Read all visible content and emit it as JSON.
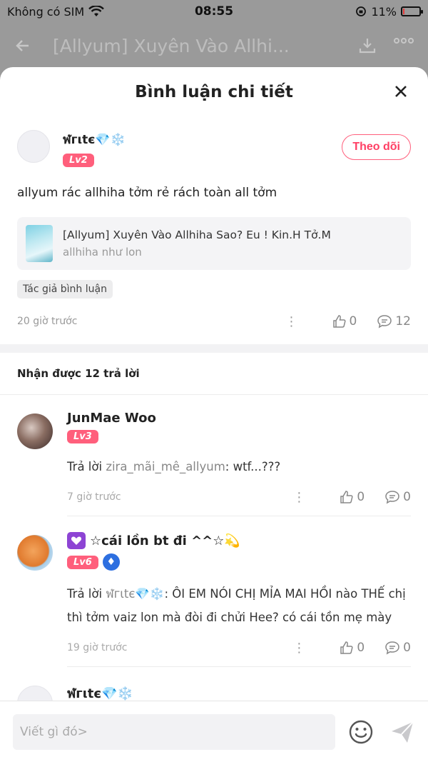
{
  "status_bar": {
    "carrier": "Không có SIM",
    "time": "08:55",
    "battery": "11%",
    "battery_level": 0.11
  },
  "underlying_page": {
    "title": "[Allyum] Xuyên Vào Allhi..."
  },
  "sheet": {
    "title": "Bình luận chi tiết"
  },
  "main_comment": {
    "author": "ฬгιtє💎❄️",
    "level": "Lv2",
    "follow_label": "Theo dõi",
    "text": "allyum rác allhiha tởm rẻ rách toàn all tởm",
    "book": {
      "title": "[Allyum] Xuyên Vào Allhiha Sao? Eu ! Kin.H Tở.M",
      "subtitle": "allhiha như lon"
    },
    "tag": "Tác giả bình luận",
    "time": "20 giờ trước",
    "likes": "0",
    "replies": "12"
  },
  "replies_header": "Nhận được 12 trả lời",
  "replies": [
    {
      "author": "JunMae Woo",
      "level": "Lv3",
      "prefix": "Trả lời ",
      "mention": "zira_mãi_mê_allyum",
      "text": ": wtf...???",
      "time": "7 giờ trước",
      "likes": "0",
      "comments": "0"
    },
    {
      "author": "☆cái lồn bt đi ^^☆💫",
      "level": "Lv6",
      "prefix": "Trả lời ",
      "mention": "ฬгιtє💎❄️",
      "text": ": ÔI EM NÓI CHỊ MỈA MAI HỒI nào THẾ chị thì tởm vaiz lon mà đòi đi chửi Hee? có cái tồn mẹ mày",
      "time": "19 giờ trước",
      "likes": "0",
      "comments": "0"
    },
    {
      "author": "ฬгιtє💎❄️"
    }
  ],
  "input": {
    "placeholder": "Viết gì đó>"
  }
}
